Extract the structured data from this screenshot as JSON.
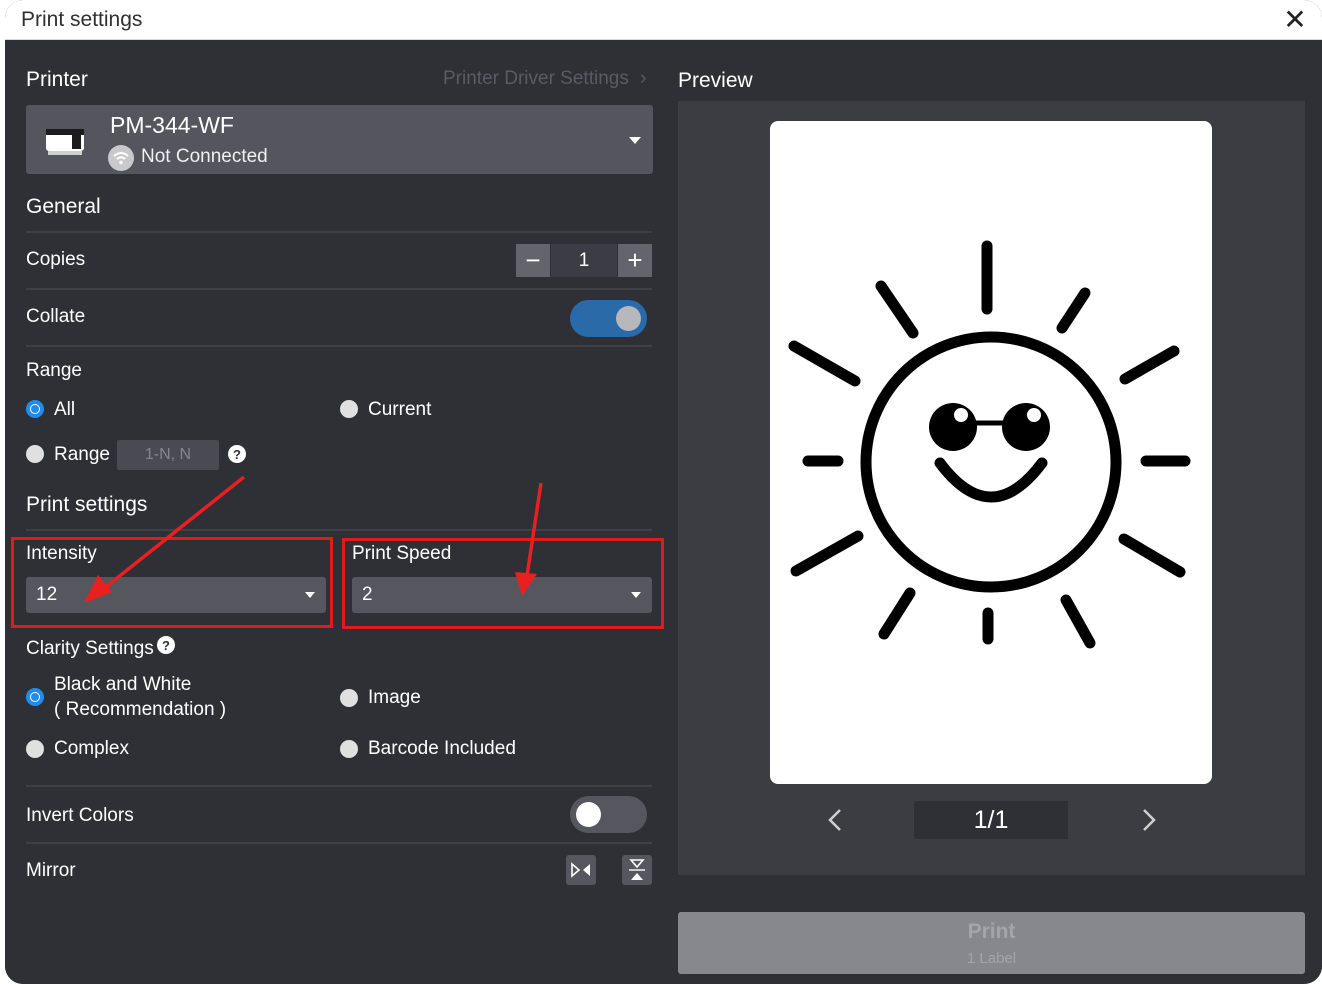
{
  "window": {
    "title": "Print settings",
    "close_icon": "close-icon"
  },
  "printer": {
    "heading": "Printer",
    "driver_link": "Printer Driver Settings",
    "name": "PM-344-WF",
    "status": "Not Connected"
  },
  "general": {
    "heading": "General",
    "copies_label": "Copies",
    "copies_value": "1",
    "collate_label": "Collate",
    "collate_on": true,
    "range_label": "Range",
    "range_options": {
      "all": "All",
      "current": "Current",
      "range": "Range"
    },
    "range_selected": "all",
    "range_placeholder": "1-N, N"
  },
  "print_settings": {
    "heading": "Print settings",
    "intensity_label": "Intensity",
    "intensity_value": "12",
    "speed_label": "Print Speed",
    "speed_value": "2",
    "clarity_label": "Clarity Settings",
    "clarity_options": {
      "bw_line1": "Black and White",
      "bw_line2": "( Recommendation )",
      "image": "Image",
      "complex": "Complex",
      "barcode": "Barcode Included"
    },
    "clarity_selected": "bw",
    "invert_label": "Invert Colors",
    "invert_on": false,
    "mirror_label": "Mirror"
  },
  "preview": {
    "heading": "Preview",
    "page_indicator": "1/1"
  },
  "print_button": {
    "label": "Print",
    "sub_label": "1 Label"
  },
  "colors": {
    "accent": "#1e8cf0",
    "toggle_on": "#2b6aa8",
    "highlight": "#e11a1a",
    "background": "#2f3036"
  }
}
